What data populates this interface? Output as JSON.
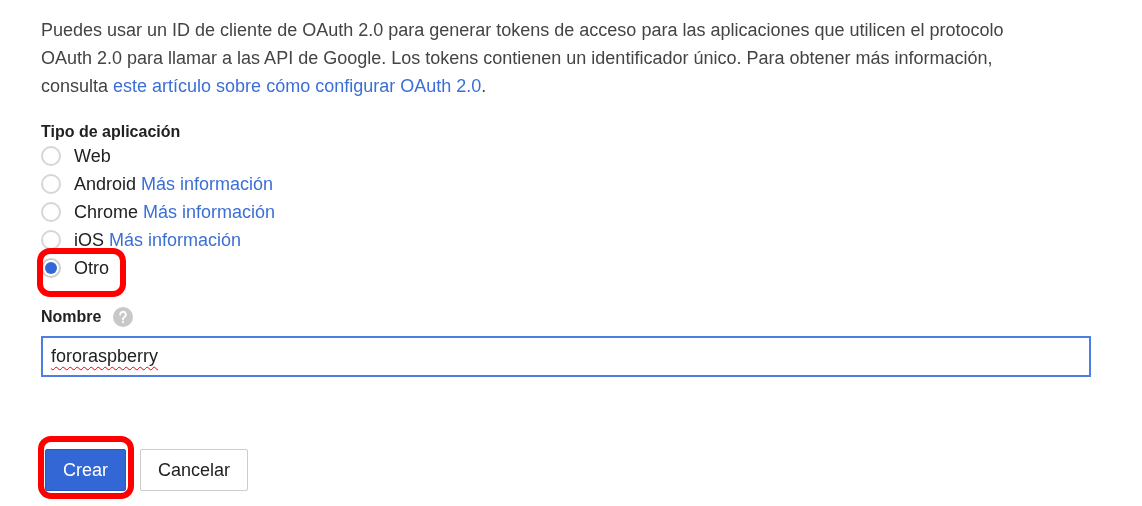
{
  "intro": {
    "text": "Puedes usar un ID de cliente de OAuth 2.0 para generar tokens de acceso para las aplicaciones que utilicen el protocolo OAuth 2.0 para llamar a las API de Google. Los tokens contienen un identificador único. Para obtener más información, consulta ",
    "link": "este artículo sobre cómo configurar OAuth 2.0",
    "after": "."
  },
  "app_type": {
    "label": "Tipo de aplicación",
    "options": [
      {
        "label": "Web",
        "selected": false,
        "highlighted": false
      },
      {
        "label": "Android",
        "link": "Más información",
        "selected": false,
        "highlighted": false
      },
      {
        "label": "Chrome",
        "link": "Más información",
        "selected": false,
        "highlighted": false
      },
      {
        "label": "iOS",
        "link": "Más información",
        "selected": false,
        "highlighted": false
      },
      {
        "label": "Otro",
        "selected": true,
        "highlighted": true
      }
    ]
  },
  "name_field": {
    "label": "Nombre",
    "value": "fororaspberry",
    "misspelled": true
  },
  "buttons": [
    {
      "label": "Crear",
      "kind": "primary",
      "highlighted": true
    },
    {
      "label": "Cancelar",
      "kind": "secondary",
      "highlighted": false
    }
  ]
}
